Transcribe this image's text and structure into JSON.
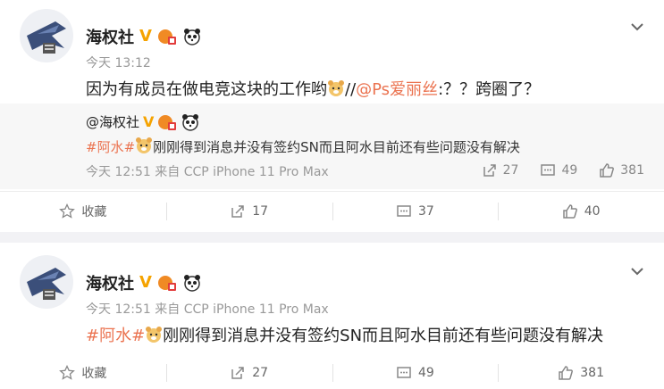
{
  "post1": {
    "name": "海权社",
    "vbadge": "V",
    "time": "今天 13:12",
    "text_a": "因为有成员在做电竞这块的工作哟",
    "text_b": "//",
    "mention": "@Ps爱丽丝",
    "text_c": ":？？跨圈了？",
    "repost": {
      "name": "@海权社",
      "hashtag": "#阿水#",
      "text": "刚刚得到消息并没有签约SN而且阿水目前还有些问题没有解决",
      "meta": "今天 12:51 来自 CCP iPhone 11 Pro Max",
      "reposts": "27",
      "comments": "49",
      "likes": "381"
    },
    "actions": {
      "favorite": "收藏",
      "forward": "17",
      "comment": "37",
      "like": "40"
    }
  },
  "post2": {
    "name": "海权社",
    "vbadge": "V",
    "meta": "今天 12:51 来自 CCP iPhone 11 Pro Max",
    "hashtag": "#阿水#",
    "text": "刚刚得到消息并没有签约SN而且阿水目前还有些问题没有解决",
    "actions": {
      "favorite": "收藏",
      "forward": "27",
      "comment": "49",
      "like": "381"
    }
  },
  "colors": {
    "link": "#eb7350",
    "vbadge": "#f5a300",
    "meta": "#999999"
  }
}
